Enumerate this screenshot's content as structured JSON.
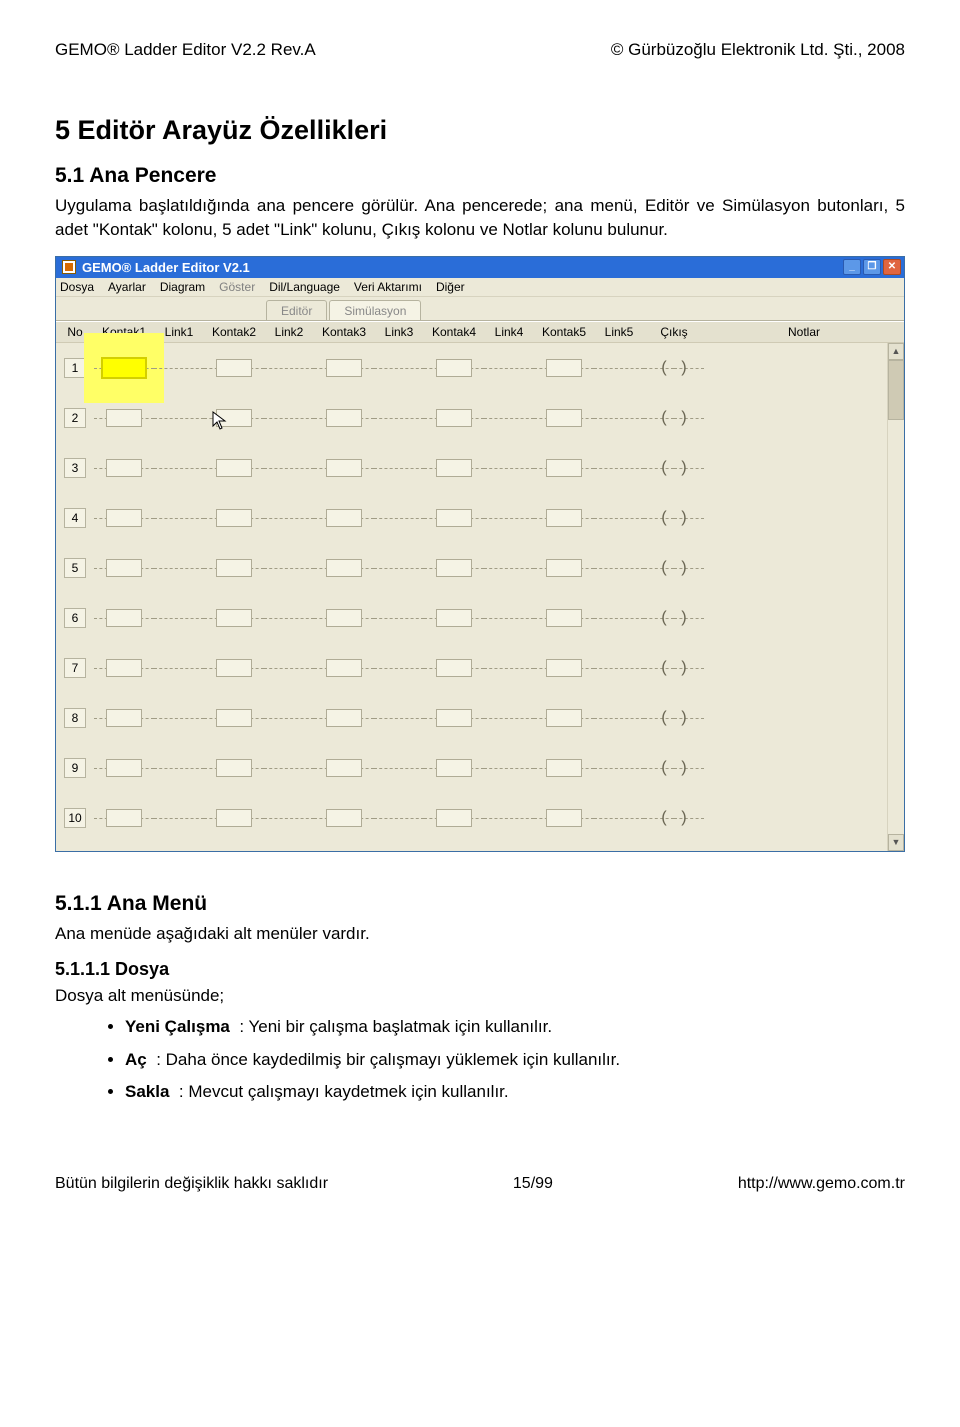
{
  "header": {
    "left": "GEMO® Ladder Editor V2.2 Rev.A",
    "right": "© Gürbüzoğlu Elektronik Ltd. Şti., 2008"
  },
  "sec5": {
    "title": "5  Editör Arayüz Özellikleri",
    "sub1_title": "5.1  Ana Pencere",
    "para": "Uygulama başlatıldığında ana pencere görülür. Ana pencerede; ana menü, Editör ve Simülasyon butonları, 5 adet \"Kontak\" kolonu, 5 adet \"Link\" kolunu, Çıkış kolonu ve Notlar kolunu bulunur."
  },
  "app": {
    "title": "GEMO® Ladder Editor V2.1",
    "menu": {
      "dosya": "Dosya",
      "ayarlar": "Ayarlar",
      "diagram": "Diagram",
      "goster": "Göster",
      "dil": "Dil/Language",
      "veri": "Veri Aktarımı",
      "diger": "Diğer"
    },
    "tabs": {
      "editor": "Editör",
      "sim": "Simülasyon"
    },
    "cols": {
      "no": "No",
      "k1": "Kontak1",
      "l1": "Link1",
      "k2": "Kontak2",
      "l2": "Link2",
      "k3": "Kontak3",
      "l3": "Link3",
      "k4": "Kontak4",
      "l4": "Link4",
      "k5": "Kontak5",
      "l5": "Link5",
      "out": "Çıkış",
      "notes": "Notlar"
    },
    "coil": "(  )",
    "rows": [
      "1",
      "2",
      "3",
      "4",
      "5",
      "6",
      "7",
      "8",
      "9",
      "10"
    ]
  },
  "sec511": {
    "title": "5.1.1  Ana Menü",
    "text": "Ana menüde aşağıdaki alt menüler vardır."
  },
  "sec5111": {
    "title": "5.1.1.1  Dosya",
    "lead": "Dosya alt menüsünde;",
    "items": [
      {
        "k": "Yeni Çalışma",
        "v": ": Yeni bir çalışma başlatmak için kullanılır."
      },
      {
        "k": "Aç",
        "v": ": Daha önce kaydedilmiş bir çalışmayı yüklemek için kullanılır."
      },
      {
        "k": "Sakla",
        "v": ": Mevcut çalışmayı kaydetmek için kullanılır."
      }
    ]
  },
  "footer": {
    "left": "Bütün bilgilerin değişiklik hakkı saklıdır",
    "center": "15/99",
    "right": "http://www.gemo.com.tr"
  }
}
